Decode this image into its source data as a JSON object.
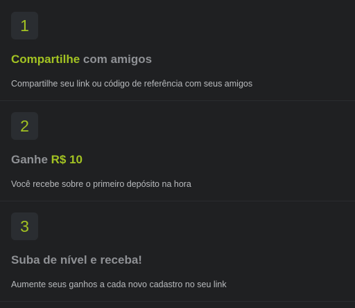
{
  "steps": [
    {
      "number": "1",
      "title_highlight": "Compartilhe",
      "title_rest": " com amigos",
      "description": "Compartilhe seu link ou código de referência com seus amigos"
    },
    {
      "number": "2",
      "title_prefix": "Ganhe ",
      "title_highlight": "R$ 10",
      "description": "Você recebe sobre o primeiro depósito na hora"
    },
    {
      "number": "3",
      "title": "Suba de nível e receba!",
      "description": "Aumente seus ganhos a cada novo cadastro no seu link"
    }
  ],
  "colors": {
    "background": "#1f2022",
    "accent": "#a3c322",
    "badge_bg": "#2a2d31",
    "title_text": "#8f9195",
    "body_text": "#b9bbbe"
  }
}
